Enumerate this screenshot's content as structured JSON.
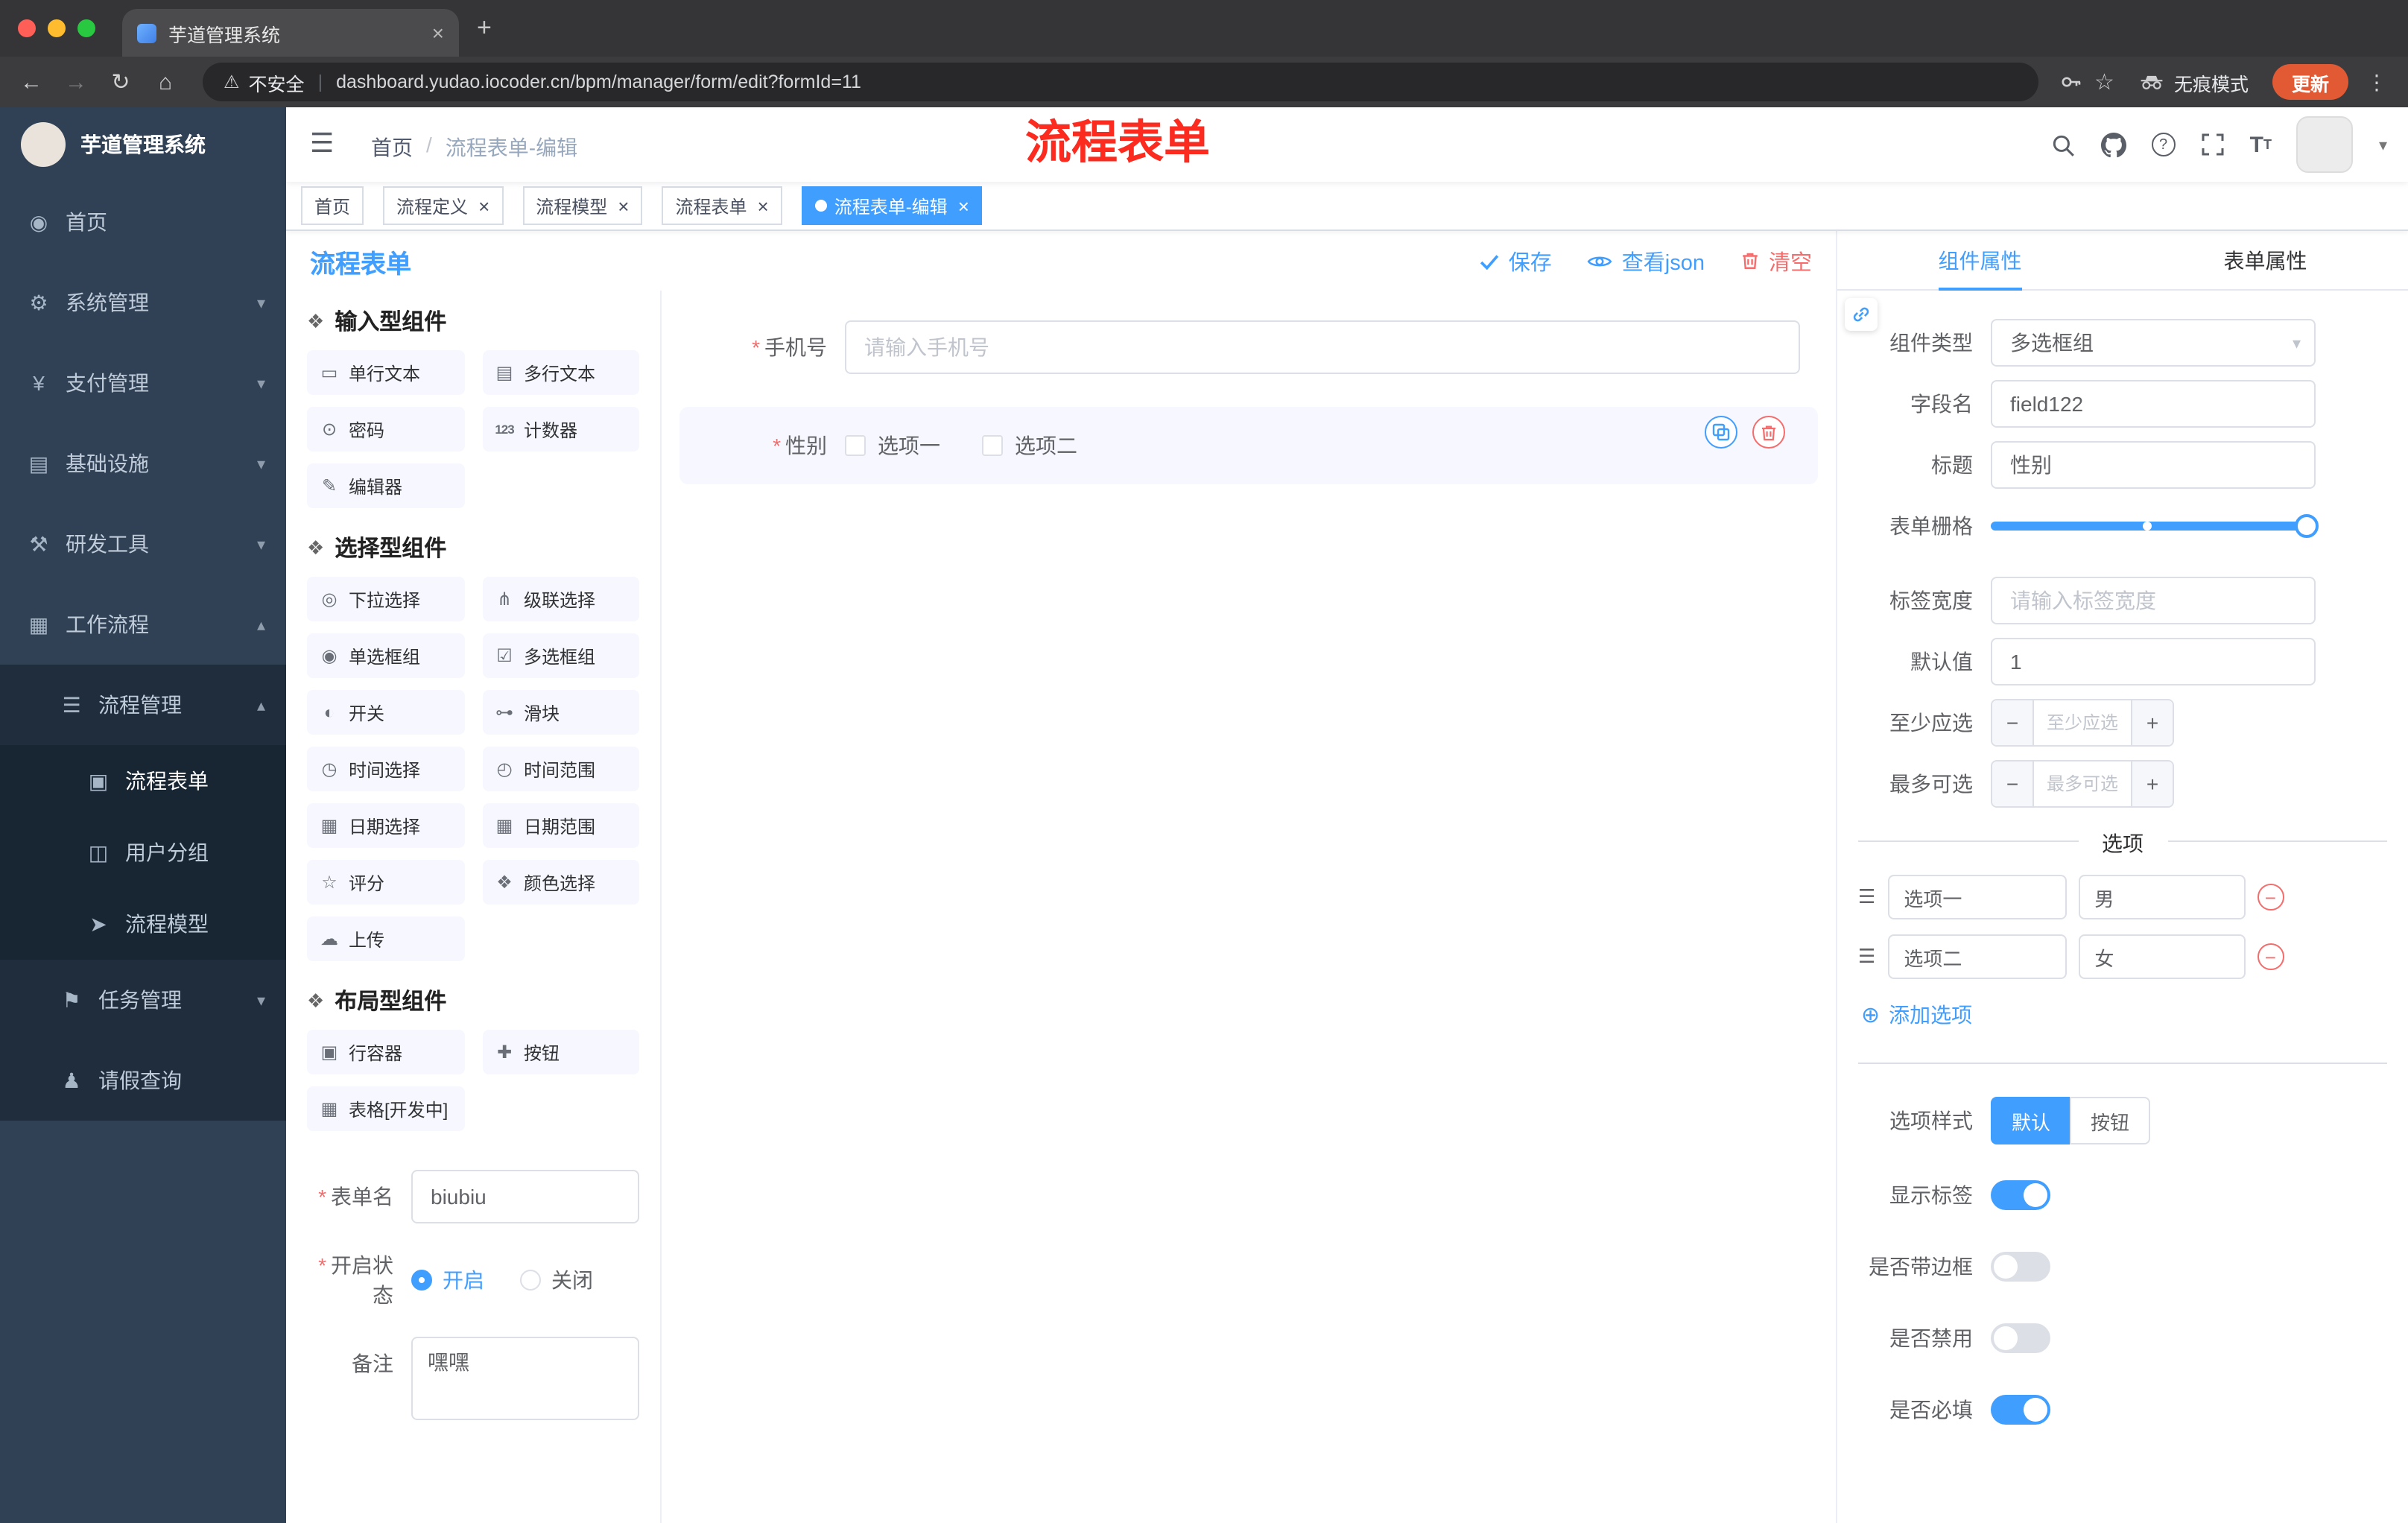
{
  "colors": {
    "accent": "#409eff",
    "danger": "#f56c6c",
    "sidebar": "#304156",
    "update_button": "#e25a33",
    "active_tag": "#409eff"
  },
  "browser": {
    "tab_title": "芋道管理系统",
    "new_tab_button": "+",
    "security_label": "不安全",
    "url": "dashboard.yudao.iocoder.cn/bpm/manager/form/edit?formId=11",
    "incognito_label": "无痕模式",
    "update_label": "更新"
  },
  "sidebar": {
    "app_title": "芋道管理系统",
    "menu": [
      {
        "name": "home",
        "label": "首页",
        "icon": "dashboard-icon",
        "level": 0
      },
      {
        "name": "system-management",
        "label": "系统管理",
        "icon": "system-icon",
        "level": 0,
        "chevron": "down"
      },
      {
        "name": "payment-management",
        "label": "支付管理",
        "icon": "payment-icon",
        "level": 0,
        "chevron": "down"
      },
      {
        "name": "infrastructure",
        "label": "基础设施",
        "icon": "infrastructure-icon",
        "level": 0,
        "chevron": "down"
      },
      {
        "name": "dev-tools",
        "label": "研发工具",
        "icon": "devtools-icon",
        "level": 0,
        "chevron": "down"
      },
      {
        "name": "workflow",
        "label": "工作流程",
        "icon": "workflow-icon",
        "level": 0,
        "chevron": "up"
      },
      {
        "name": "process-management",
        "label": "流程管理",
        "icon": "process-manage-icon",
        "level": 1,
        "chevron": "up"
      },
      {
        "name": "process-form",
        "label": "流程表单",
        "icon": "process-form-icon",
        "level": 2,
        "active": true
      },
      {
        "name": "user-group",
        "label": "用户分组",
        "icon": "user-group-icon",
        "level": 2
      },
      {
        "name": "process-model",
        "label": "流程模型",
        "icon": "process-model-icon",
        "level": 2
      },
      {
        "name": "task-management",
        "label": "任务管理",
        "icon": "task-manage-icon",
        "level": 1,
        "chevron": "down"
      },
      {
        "name": "leave-query",
        "label": "请假查询",
        "icon": "leave-query-icon",
        "level": 1
      }
    ]
  },
  "header": {
    "breadcrumb": {
      "root": "首页",
      "current": "流程表单-编辑"
    },
    "annotation": "流程表单"
  },
  "tags": [
    {
      "name": "home",
      "label": "首页",
      "closable": false,
      "active": false
    },
    {
      "name": "process-definition",
      "label": "流程定义",
      "closable": true,
      "active": false
    },
    {
      "name": "process-model",
      "label": "流程模型",
      "closable": true,
      "active": false
    },
    {
      "name": "process-form",
      "label": "流程表单",
      "closable": true,
      "active": false
    },
    {
      "name": "process-form-edit",
      "label": "流程表单-编辑",
      "closable": true,
      "active": true
    }
  ],
  "designer": {
    "page_title": "流程表单",
    "toolbar": {
      "save": "保存",
      "view_json": "查看json",
      "clear": "清空"
    },
    "palette": {
      "sections": [
        {
          "title": "输入型组件",
          "items": [
            {
              "name": "single-line-text",
              "label": "单行文本",
              "icon": "input-icon"
            },
            {
              "name": "multi-line-text",
              "label": "多行文本",
              "icon": "textarea-icon"
            },
            {
              "name": "password",
              "label": "密码",
              "icon": "password-icon"
            },
            {
              "name": "counter",
              "label": "计数器",
              "icon": "number-icon"
            },
            {
              "name": "editor",
              "label": "编辑器",
              "icon": "editor-icon"
            }
          ]
        },
        {
          "title": "选择型组件",
          "items": [
            {
              "name": "select",
              "label": "下拉选择",
              "icon": "select-icon"
            },
            {
              "name": "cascader",
              "label": "级联选择",
              "icon": "cascader-icon"
            },
            {
              "name": "radio-group",
              "label": "单选框组",
              "icon": "radio-icon"
            },
            {
              "name": "checkbox-group",
              "label": "多选框组",
              "icon": "checkbox-icon"
            },
            {
              "name": "switch",
              "label": "开关",
              "icon": "switch-icon"
            },
            {
              "name": "slider",
              "label": "滑块",
              "icon": "slider-icon"
            },
            {
              "name": "time-picker",
              "label": "时间选择",
              "icon": "time-icon"
            },
            {
              "name": "time-range",
              "label": "时间范围",
              "icon": "time-range-icon"
            },
            {
              "name": "date-picker",
              "label": "日期选择",
              "icon": "date-icon"
            },
            {
              "name": "date-range",
              "label": "日期范围",
              "icon": "date-range-icon"
            },
            {
              "name": "rate",
              "label": "评分",
              "icon": "rate-icon"
            },
            {
              "name": "color-picker",
              "label": "颜色选择",
              "icon": "color-icon"
            },
            {
              "name": "upload",
              "label": "上传",
              "icon": "upload-icon"
            }
          ]
        },
        {
          "title": "布局型组件",
          "items": [
            {
              "name": "row-container",
              "label": "行容器",
              "icon": "row-icon"
            },
            {
              "name": "button",
              "label": "按钮",
              "icon": "button-icon"
            },
            {
              "name": "table-dev",
              "label": "表格[开发中]",
              "icon": "table-icon"
            }
          ]
        }
      ],
      "form": {
        "name_label": "表单名",
        "name_value": "biubiu",
        "status_label": "开启状态",
        "status_options": [
          {
            "label": "开启",
            "checked": true
          },
          {
            "label": "关闭",
            "checked": false
          }
        ],
        "remark_label": "备注",
        "remark_value": "嘿嘿"
      }
    },
    "canvas": {
      "fields": [
        {
          "label": "手机号",
          "required": true,
          "type": "input",
          "placeholder": "请输入手机号"
        },
        {
          "label": "性别",
          "required": true,
          "type": "checkbox-group",
          "options": [
            "选项一",
            "选项二"
          ],
          "selected": true
        }
      ]
    },
    "properties": {
      "tabs": [
        {
          "label": "组件属性",
          "active": true
        },
        {
          "label": "表单属性",
          "active": false
        }
      ],
      "component_type": {
        "label": "组件类型",
        "value": "多选框组"
      },
      "field_name": {
        "label": "字段名",
        "value": "field122"
      },
      "title": {
        "label": "标题",
        "value": "性别"
      },
      "grid": {
        "label": "表单栅格"
      },
      "label_width": {
        "label": "标签宽度",
        "placeholder": "请输入标签宽度"
      },
      "default_value": {
        "label": "默认值",
        "value": "1"
      },
      "min_select": {
        "label": "至少应选",
        "placeholder": "至少应选"
      },
      "max_select": {
        "label": "最多可选",
        "placeholder": "最多可选"
      },
      "options_divider": "选项",
      "options": [
        {
          "label": "选项一",
          "value": "男"
        },
        {
          "label": "选项二",
          "value": "女"
        }
      ],
      "add_option": "添加选项",
      "option_style": {
        "label": "选项样式",
        "choices": [
          {
            "label": "默认",
            "active": true
          },
          {
            "label": "按钮",
            "active": false
          }
        ]
      },
      "switches": [
        {
          "name": "show-label",
          "label": "显示标签",
          "on": true
        },
        {
          "name": "with-border",
          "label": "是否带边框",
          "on": false
        },
        {
          "name": "disabled",
          "label": "是否禁用",
          "on": false
        },
        {
          "name": "required",
          "label": "是否必填",
          "on": true
        }
      ]
    }
  }
}
